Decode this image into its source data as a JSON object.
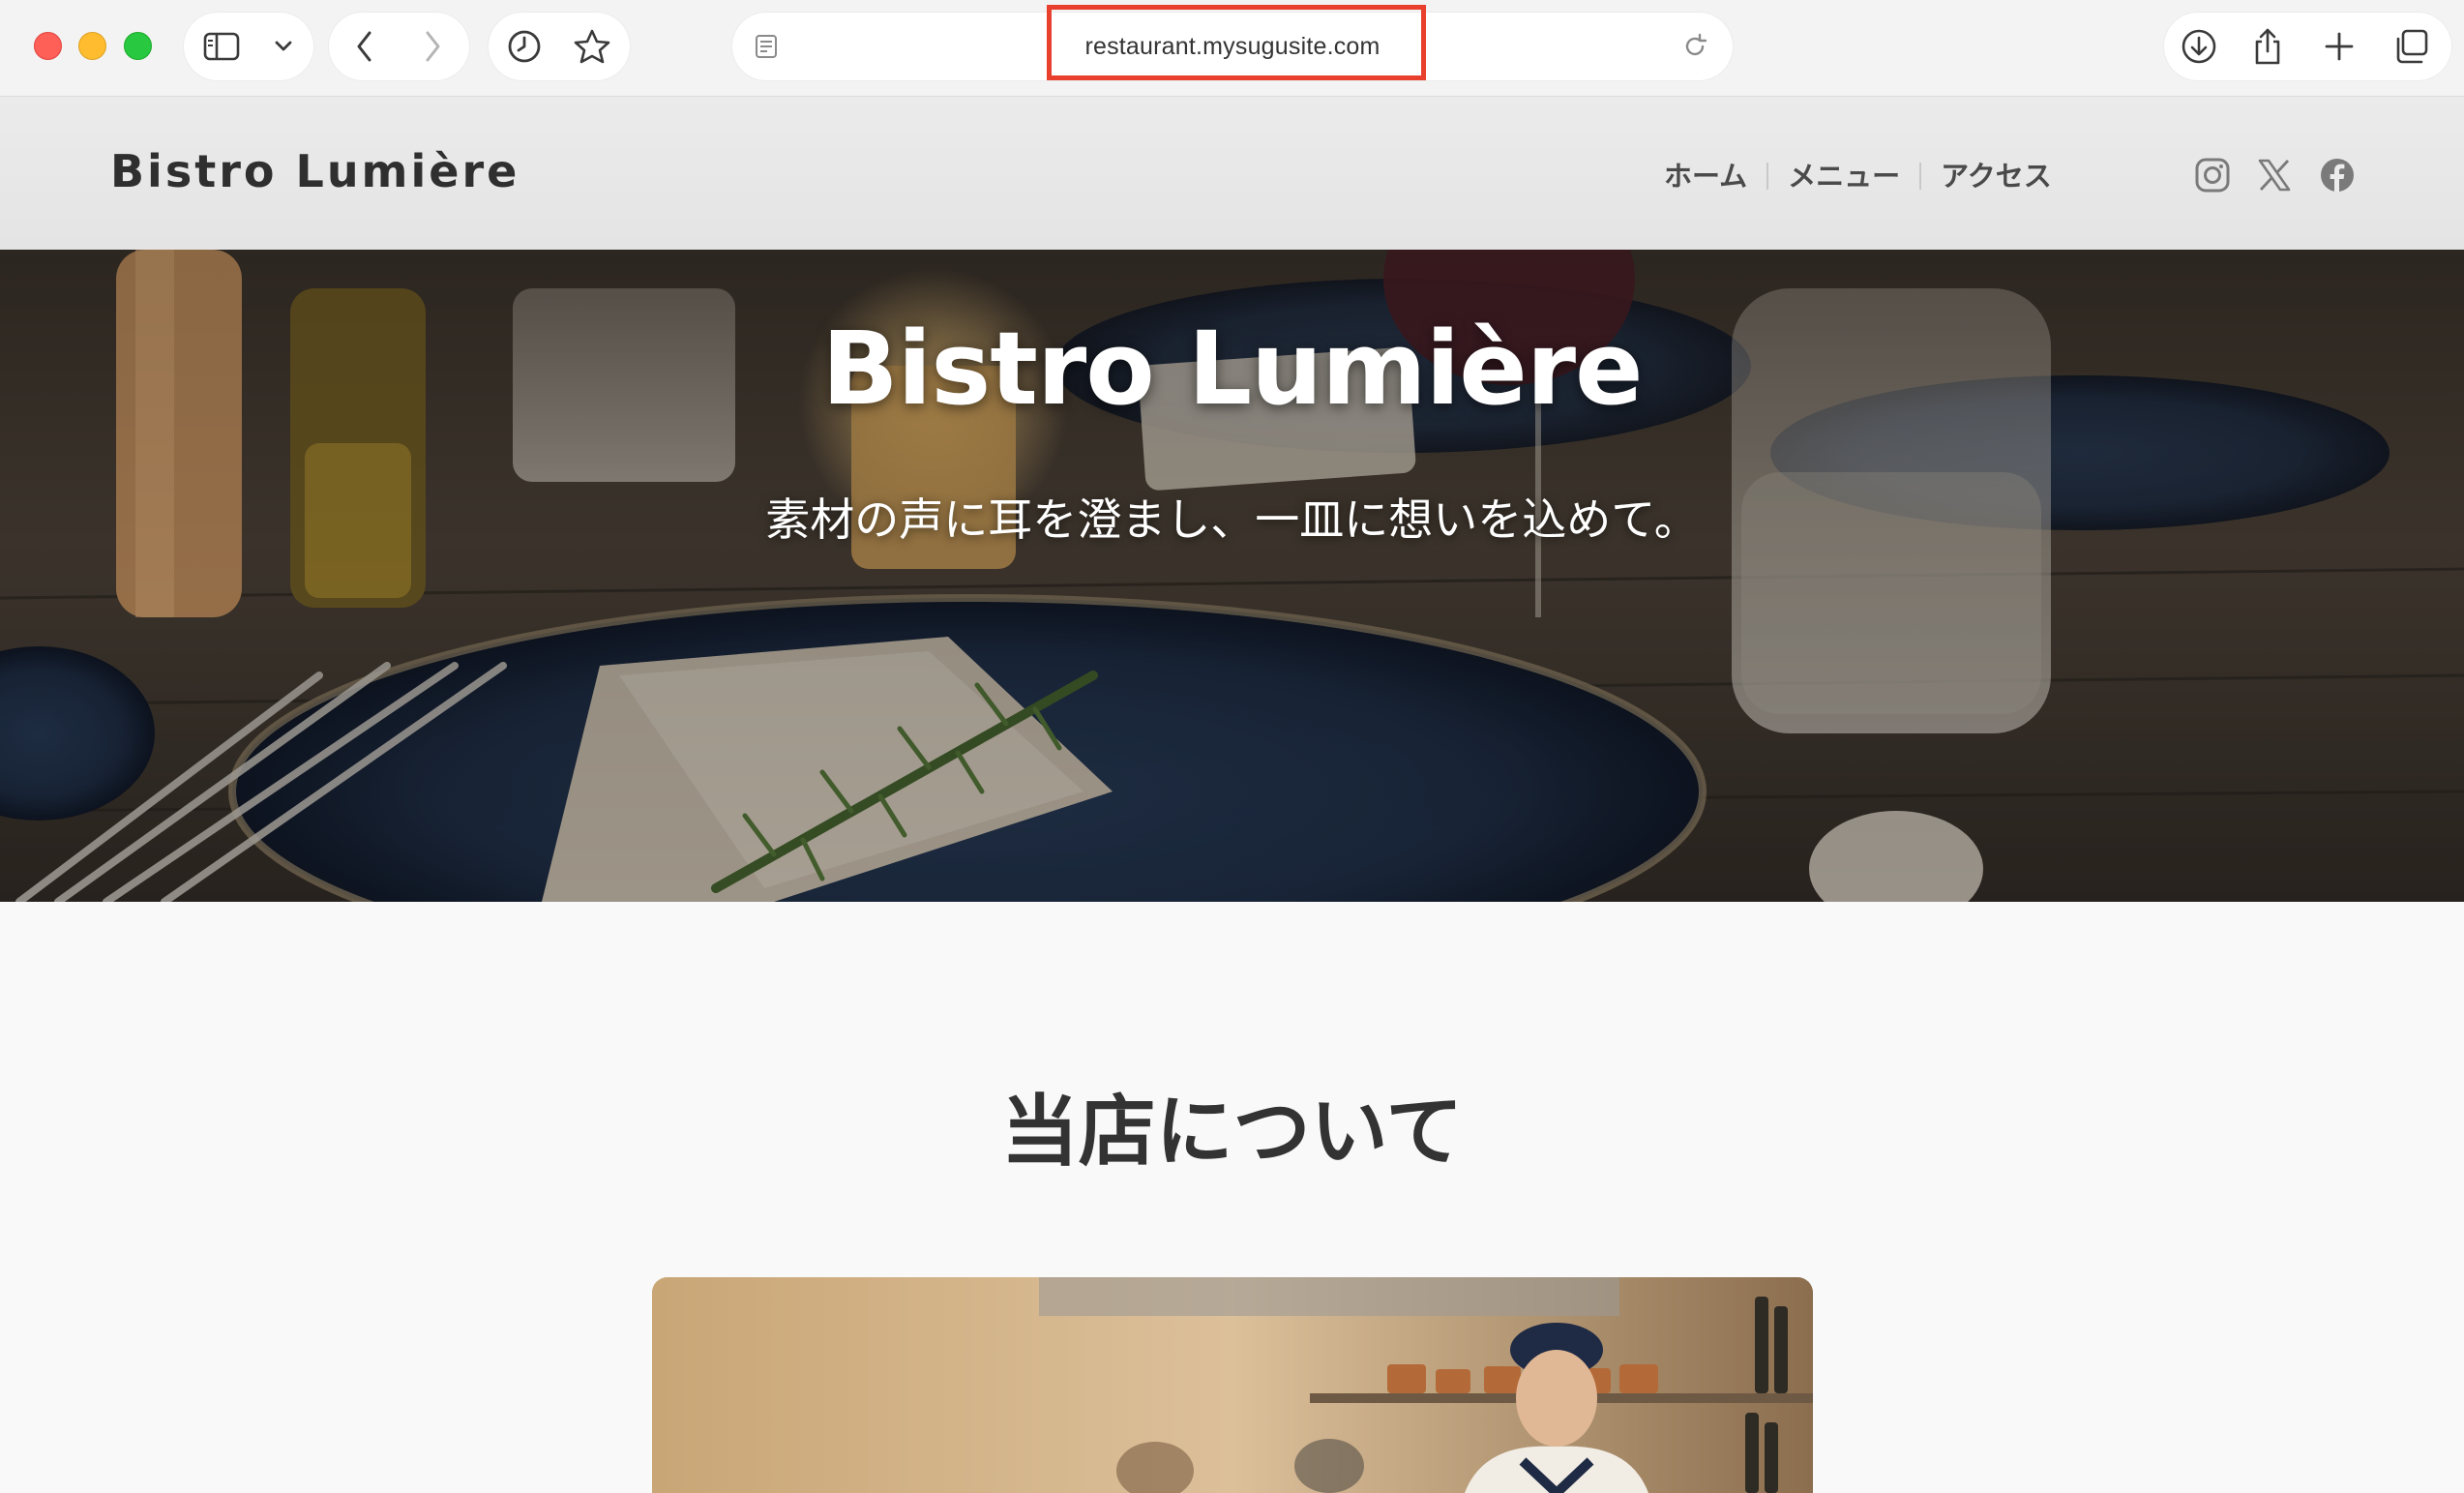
{
  "browser": {
    "url": "restaurant.mysugusite.com",
    "icons": {
      "sidebar": "sidebar-icon",
      "sidebar_menu": "chevron-down-icon",
      "back": "chevron-left-icon",
      "forward": "chevron-right-icon",
      "history": "clock-icon",
      "bookmark": "star-icon",
      "reader": "reader-icon",
      "reload": "reload-icon",
      "download": "download-icon",
      "share": "share-icon",
      "new_tab": "plus-icon",
      "tabs": "tabs-overview-icon"
    }
  },
  "site": {
    "logo": "Bistro Lumière",
    "nav": [
      {
        "label": "ホーム"
      },
      {
        "label": "メニュー"
      },
      {
        "label": "アクセス"
      }
    ],
    "socials": [
      "instagram-icon",
      "x-icon",
      "facebook-icon"
    ],
    "hero": {
      "title": "Bistro Lumière",
      "subtitle": "素材の声に耳を澄まし、一皿に想いを込めて。"
    },
    "about": {
      "title": "当店について"
    }
  },
  "colors": {
    "highlight": "#e8402d",
    "text_dark": "#333333",
    "page_bg": "#f9f9f9"
  }
}
